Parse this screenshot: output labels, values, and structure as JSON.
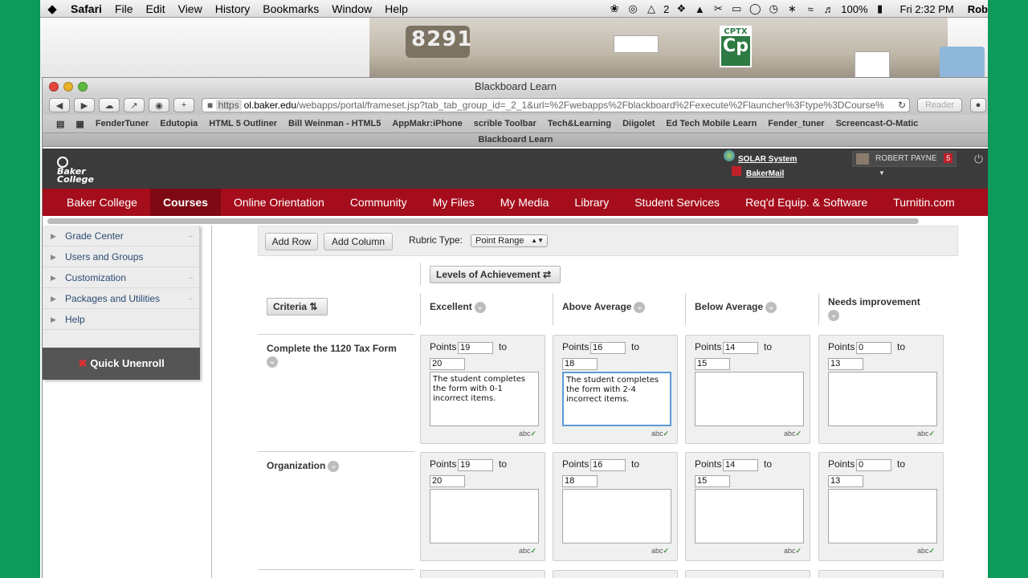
{
  "menubar": {
    "app": "Safari",
    "items": [
      "File",
      "Edit",
      "View",
      "History",
      "Bookmarks",
      "Window",
      "Help"
    ],
    "status": {
      "audio_count": "2",
      "battery": "100%",
      "clock": "Fri 2:32 PM",
      "user": "Rob"
    }
  },
  "desktop": {
    "train_number": "8291",
    "app_icon_label": "CPTX",
    "app_icon_letters": "Cp"
  },
  "browser": {
    "window_title": "Blackboard Learn",
    "url_protocol": "https",
    "url_host": "ol.baker.edu",
    "url_path": "/webapps/portal/frameset.jsp?tab_tab_group_id=_2_1&url=%2Fwebapps%2Fblackboard%2Fexecute%2Flauncher%3Ftype%3DCourse%",
    "reader_label": "Reader",
    "bookmarks": [
      "FenderTuner",
      "Edutopia",
      "HTML 5 Outliner",
      "Bill Weinman - HTML5",
      "AppMakr:iPhone",
      "scrible Toolbar",
      "Tech&Learning",
      "Diigolet",
      "Ed Tech Mobile Learn",
      "Fender_tuner",
      "Screencast-O-Matic"
    ],
    "tab_title": "Blackboard Learn"
  },
  "bb": {
    "logo_text": "Baker College",
    "solar_link": "SOLAR System",
    "mail_link": "BakerMail",
    "user_name": "ROBERT PAYNE",
    "notification_count": "5",
    "nav": [
      "Baker College",
      "Courses",
      "Online Orientation",
      "Community",
      "My Files",
      "My Media",
      "Library",
      "Student Services",
      "Req'd Equip. & Software",
      "Turnitin.com"
    ],
    "active_nav": "Courses",
    "menu": [
      "Grade Center",
      "Users and Groups",
      "Customization",
      "Packages and Utilities",
      "Help"
    ],
    "quick_unenroll": "Quick Unenroll"
  },
  "rubric": {
    "add_row": "Add Row",
    "add_column": "Add Column",
    "type_label": "Rubric Type:",
    "type_value": "Point Range",
    "levels_label": "Levels of Achievement",
    "criteria_label": "Criteria",
    "columns": [
      "Excellent",
      "Above Average",
      "Below Average",
      "Needs improvement"
    ],
    "points_label": "Points",
    "to_label": "to",
    "spell_label": "abc",
    "rows": [
      {
        "label": "Complete the 1120 Tax Form",
        "cells": [
          {
            "from": "19",
            "to": "20",
            "text": "The student completes\nthe form with 0-1\nincorrect items."
          },
          {
            "from": "16",
            "to": "18",
            "text": "The student completes\nthe form with 2-4\nincorrect items."
          },
          {
            "from": "14",
            "to": "15",
            "text": ""
          },
          {
            "from": "0",
            "to": "13",
            "text": ""
          }
        ]
      },
      {
        "label": "Organization",
        "cells": [
          {
            "from": "19",
            "to": "20",
            "text": ""
          },
          {
            "from": "16",
            "to": "18",
            "text": ""
          },
          {
            "from": "14",
            "to": "15",
            "text": ""
          },
          {
            "from": "0",
            "to": "13",
            "text": ""
          }
        ]
      }
    ]
  }
}
